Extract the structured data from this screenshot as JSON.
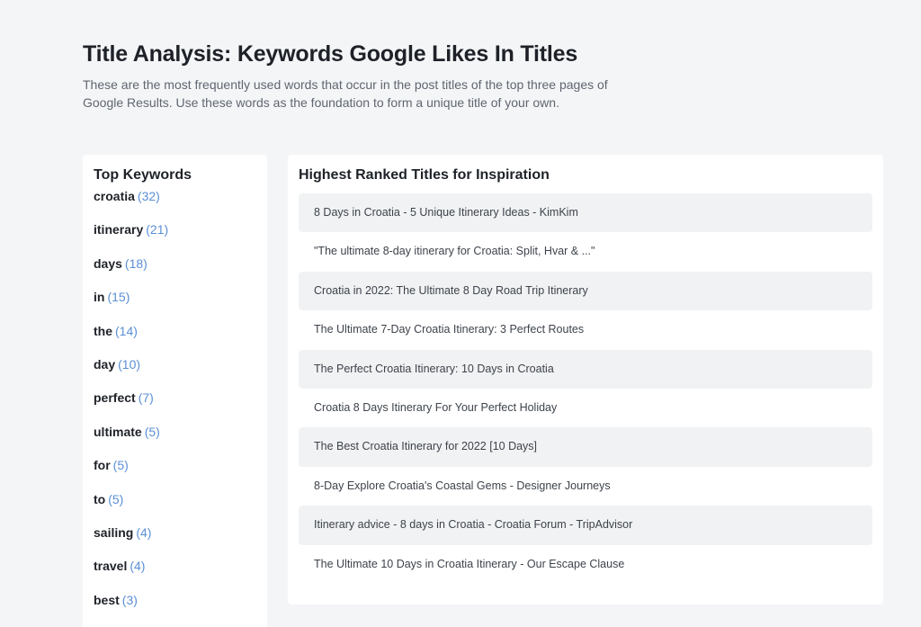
{
  "header": {
    "title": "Title Analysis: Keywords Google Likes In Titles",
    "subtitle": "These are the most frequently used words that occur in the post titles of the top three pages of Google Results. Use these words as the foundation to form a unique title of your own."
  },
  "keywords": {
    "heading": "Top Keywords",
    "items": [
      {
        "word": "croatia",
        "count": "(32)"
      },
      {
        "word": "itinerary",
        "count": "(21)"
      },
      {
        "word": "days",
        "count": "(18)"
      },
      {
        "word": "in",
        "count": "(15)"
      },
      {
        "word": "the",
        "count": "(14)"
      },
      {
        "word": "day",
        "count": "(10)"
      },
      {
        "word": "perfect",
        "count": "(7)"
      },
      {
        "word": "ultimate",
        "count": "(5)"
      },
      {
        "word": "for",
        "count": "(5)"
      },
      {
        "word": "to",
        "count": "(5)"
      },
      {
        "word": "sailing",
        "count": "(4)"
      },
      {
        "word": "travel",
        "count": "(4)"
      },
      {
        "word": "best",
        "count": "(3)"
      }
    ]
  },
  "inspiration": {
    "heading": "Highest Ranked Titles for Inspiration",
    "titles": [
      "8 Days in Croatia - 5 Unique Itinerary Ideas - KimKim",
      "\"The ultimate 8-day itinerary for Croatia: Split, Hvar & ...\"",
      "Croatia in 2022: The Ultimate 8 Day Road Trip Itinerary",
      "The Ultimate 7-Day Croatia Itinerary: 3 Perfect Routes",
      "The Perfect Croatia Itinerary: 10 Days in Croatia",
      "Croatia 8 Days Itinerary For Your Perfect Holiday",
      "The Best Croatia Itinerary for 2022 [10 Days]",
      "8-Day Explore Croatia's Coastal Gems - Designer Journeys",
      "Itinerary advice - 8 days in Croatia - Croatia Forum - TripAdvisor",
      "The Ultimate 10 Days in Croatia Itinerary - Our Escape Clause"
    ]
  },
  "colors": {
    "background": "#f4f5f7",
    "card": "#ffffff",
    "count_accent": "#5b8fd6",
    "row_shade": "#f1f2f3"
  }
}
